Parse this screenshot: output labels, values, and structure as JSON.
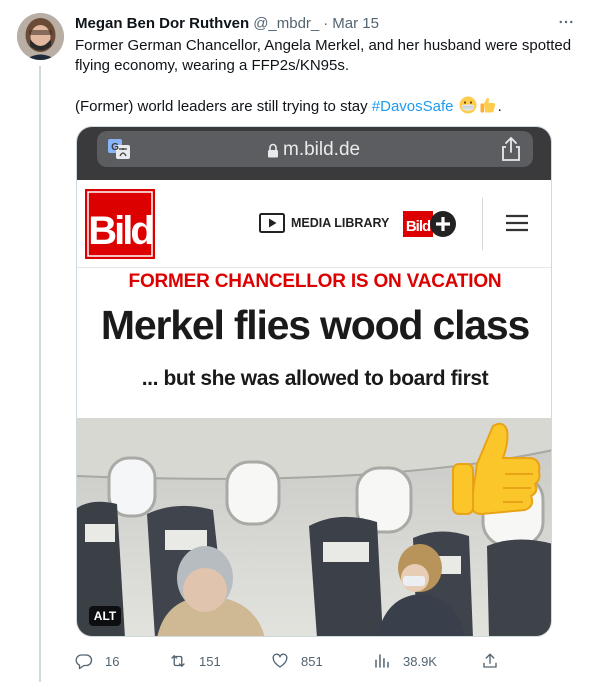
{
  "tweet": {
    "author_name": "Megan Ben Dor Ruthven",
    "handle": "@_mbdr_",
    "separator": "·",
    "date": "Mar 15",
    "text_line1": "Former German Chancellor, Angela Merkel, and her husband were spotted flying economy, wearing a FFP2s/KN95s.",
    "text_line2_prefix": "(Former) world leaders are still trying to stay",
    "hashtag": "#DavosSafe",
    "text_line2_suffix": ".",
    "emojis": [
      "mask-face-emoji",
      "thumbs-up-emoji"
    ]
  },
  "media": {
    "browser": {
      "url": "m.bild.de"
    },
    "site": {
      "logo_text": "Bild",
      "media_library_label": "MEDIA LIBRARY",
      "bildplus_text": "Bild",
      "kicker": "FORMER CHANCELLOR IS ON VACATION",
      "headline": "Merkel flies wood class",
      "subline": "... but she was allowed to board first"
    },
    "alt_label": "ALT"
  },
  "actions": {
    "replies": "16",
    "retweets": "151",
    "likes": "851",
    "views": "38.9K"
  },
  "colors": {
    "accent": "#1d9bf0",
    "secondary_text": "#536471",
    "bild_red": "#dd0000"
  }
}
